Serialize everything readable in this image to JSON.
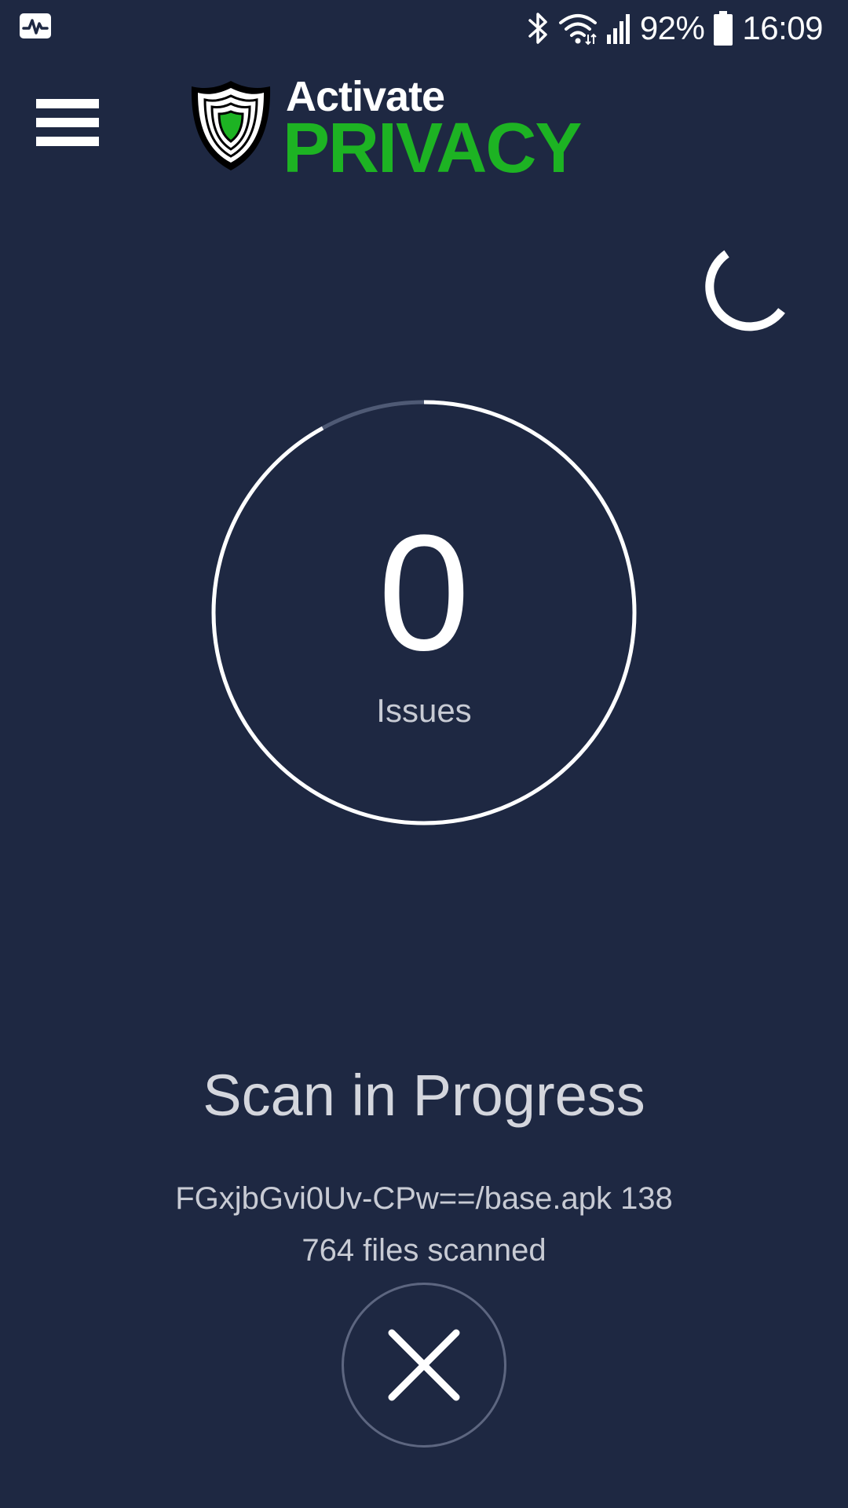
{
  "status_bar": {
    "left_icon": "activity-monitor-icon",
    "icons": [
      "bluetooth-icon",
      "wifi-icon",
      "signal-icon"
    ],
    "battery_percent": "92%",
    "battery_icon": "battery-icon",
    "time": "16:09"
  },
  "app_bar": {
    "menu_icon": "hamburger-menu-icon",
    "logo": {
      "line1": "Activate",
      "line2": "PRIVACY",
      "line2_color": "#1db323",
      "shield_icon": "shield-icon"
    }
  },
  "spinner": {
    "icon": "loading-spinner-icon"
  },
  "scan_ring": {
    "issue_count": "0",
    "label": "Issues",
    "progress_fraction": 0.92
  },
  "scan": {
    "title": "Scan in Progress",
    "current_file": "FGxjbGvi0Uv-CPw==/base.apk 138",
    "files_scanned": "764 files scanned"
  },
  "cancel": {
    "icon": "close-icon"
  },
  "colors": {
    "background": "#1e2842",
    "accent_green": "#1db323",
    "ring_track": "#4f5a75",
    "ring_progress": "#ffffff"
  }
}
